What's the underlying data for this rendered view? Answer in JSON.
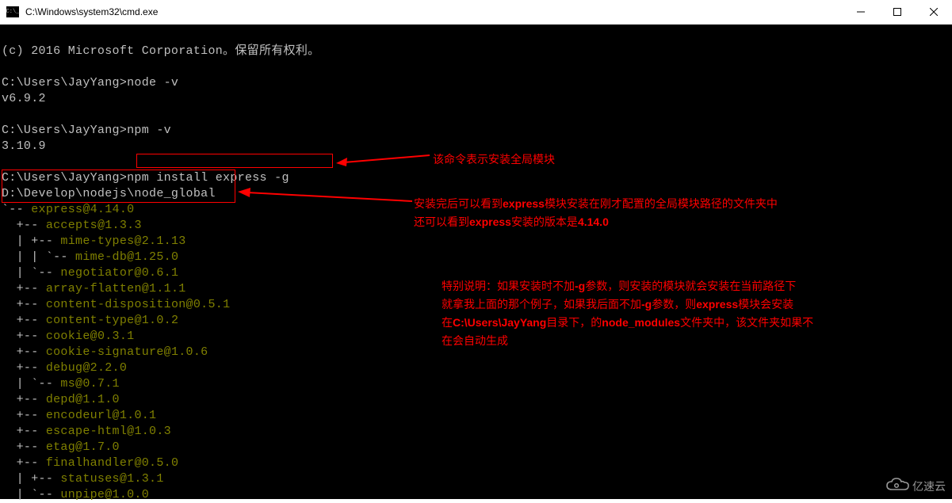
{
  "window": {
    "title": "C:\\Windows\\system32\\cmd.exe"
  },
  "terminal": {
    "copyright": "(c) 2016 Microsoft Corporation。保留所有权利。",
    "prompt1": "C:\\Users\\JayYang>node -v",
    "out1": "v6.9.2",
    "prompt2": "C:\\Users\\JayYang>npm -v",
    "out2": "3.10.9",
    "prompt3_pre": "C:\\Users\\JayYang>",
    "prompt3_cmd": "npm install express -g",
    "path_line": "D:\\Develop\\nodejs\\node_global",
    "express_line_pre": "`-- ",
    "express_line_pkg": "express@4.14.0",
    "tree": [
      "+-- accepts@1.3.3",
      "| +-- mime-types@2.1.13",
      "| | `-- mime-db@1.25.0",
      "| `-- negotiator@0.6.1",
      "+-- array-flatten@1.1.1",
      "+-- content-disposition@0.5.1",
      "+-- content-type@1.0.2",
      "+-- cookie@0.3.1",
      "+-- cookie-signature@1.0.6",
      "+-- debug@2.2.0",
      "| `-- ms@0.7.1",
      "+-- depd@1.1.0",
      "+-- encodeurl@1.0.1",
      "+-- escape-html@1.0.3",
      "+-- etag@1.7.0",
      "+-- finalhandler@0.5.0",
      "| +-- statuses@1.3.1",
      "| `-- unpipe@1.0.0"
    ]
  },
  "annotations": {
    "a1": "该命令表示安装全局模块",
    "a2_part1": "安装完后可以看到",
    "a2_part2": "模块安装在刚才配置的全局模块路径的文件夹中",
    "a2_part3": "还可以看到",
    "a2_part4": "安装的版本是",
    "a2_bold1": "express",
    "a2_bold2": "express",
    "a2_bold3": "4.14.0",
    "a3_l1a": "特别说明：如果安装时不加",
    "a3_l1b": "参数，则安装的模块就会安装在当前路径下",
    "a3_l2a": "就拿我上面的那个例子，如果我后面不加",
    "a3_l2b": "参数，则",
    "a3_l2c": "模块会安装",
    "a3_l3a": "在",
    "a3_l3b": "目录下，的",
    "a3_l3c": "文件夹中，该文件夹如果不",
    "a3_l4": "在会自动生成",
    "a3_b1": "-g",
    "a3_b2": "-g",
    "a3_b3": "express",
    "a3_b4": "C:\\Users\\JayYang",
    "a3_b5": "node_modules"
  },
  "watermark": {
    "text": "亿速云"
  }
}
